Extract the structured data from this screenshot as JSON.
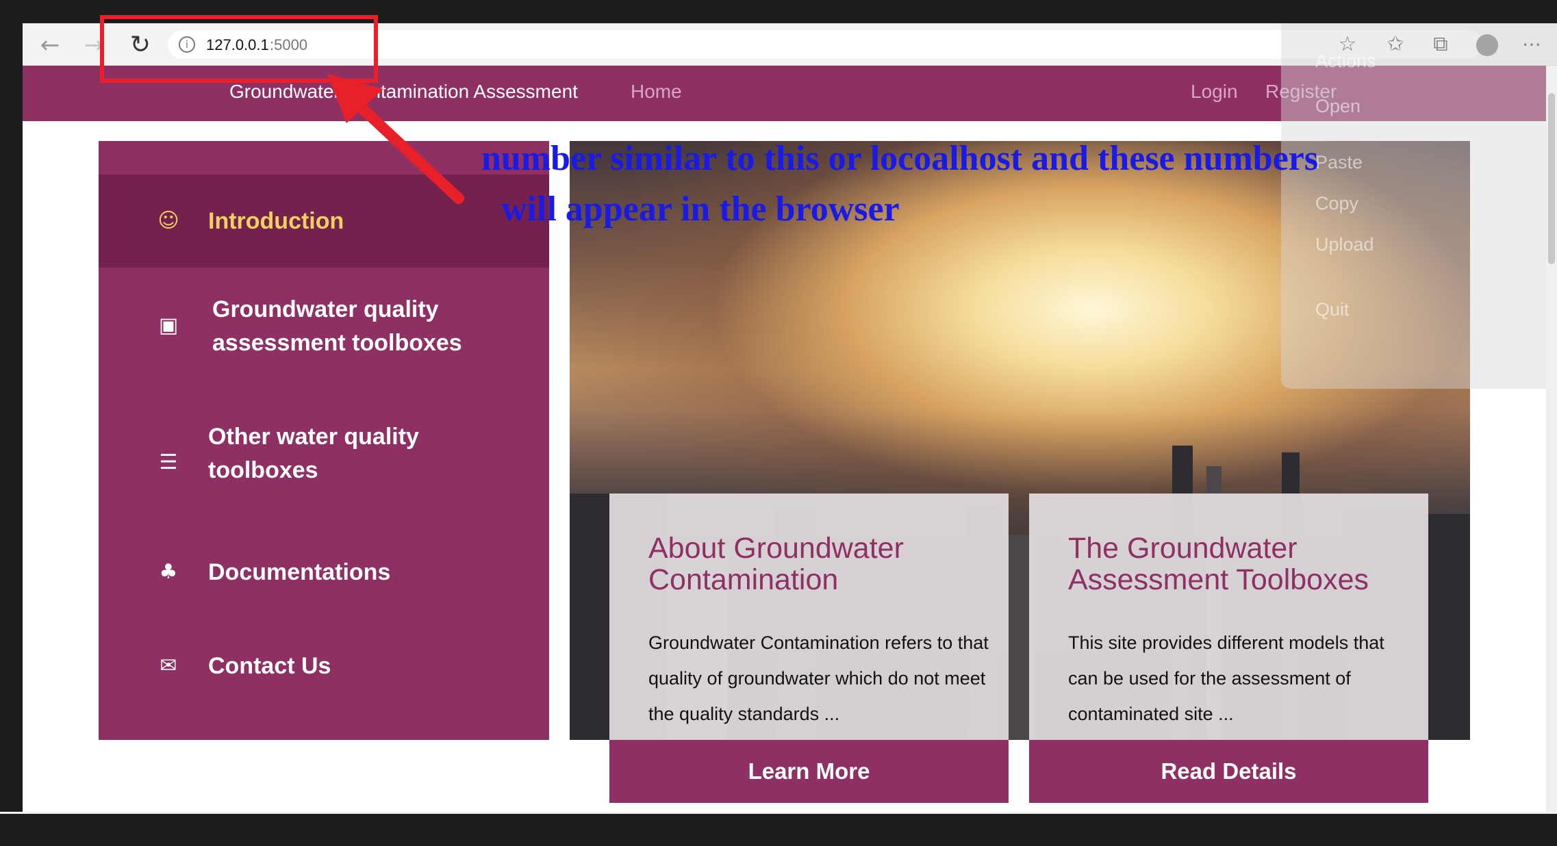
{
  "browser": {
    "url_host": "127.0.0.1",
    "url_port": ":5000",
    "icons": [
      "back-arrow-icon",
      "forward-arrow-icon",
      "reload-icon",
      "info-icon",
      "star-icon",
      "favorites-icon",
      "collections-icon",
      "profile-icon",
      "more-icon"
    ]
  },
  "navbar": {
    "brand": "Groundwater Contamination Assessment",
    "home": "Home",
    "login": "Login",
    "register": "Register"
  },
  "sidebar": {
    "items": [
      {
        "line1": "Introduction",
        "line2": "",
        "icon": "smile-icon"
      },
      {
        "line1": "Groundwater quality",
        "line2": "assessment toolboxes",
        "icon": "image-icon"
      },
      {
        "line1": "Other water quality",
        "line2": "toolboxes",
        "icon": "server-icon"
      },
      {
        "line1": "Documentations",
        "line2": "",
        "icon": "sitemap-icon"
      },
      {
        "line1": "Contact Us",
        "line2": "",
        "icon": "envelope-icon"
      }
    ]
  },
  "cards": [
    {
      "title": "About Groundwater Contamination",
      "text": "Groundwater Contamination refers to that quality of groundwater which do not meet the quality standards ...",
      "button": "Learn More"
    },
    {
      "title": "The Groundwater Assessment Toolboxes",
      "text": "This site provides different models that can be used for the assessment of contaminated site ...",
      "button": "Read Details"
    }
  ],
  "actions_menu": {
    "title": "Actions",
    "items": [
      "Open",
      "Paste",
      "Copy",
      "Upload",
      "Quit"
    ]
  },
  "annotation": {
    "line1": "number similar to this or locoalhost and these numbers",
    "line2": "will appear in the browser",
    "highlight_color": "#e8202a",
    "text_color": "#1a1ae6"
  },
  "colors": {
    "brand": "#8e3063",
    "active_item": "#74214d",
    "active_text": "#f0d060"
  }
}
